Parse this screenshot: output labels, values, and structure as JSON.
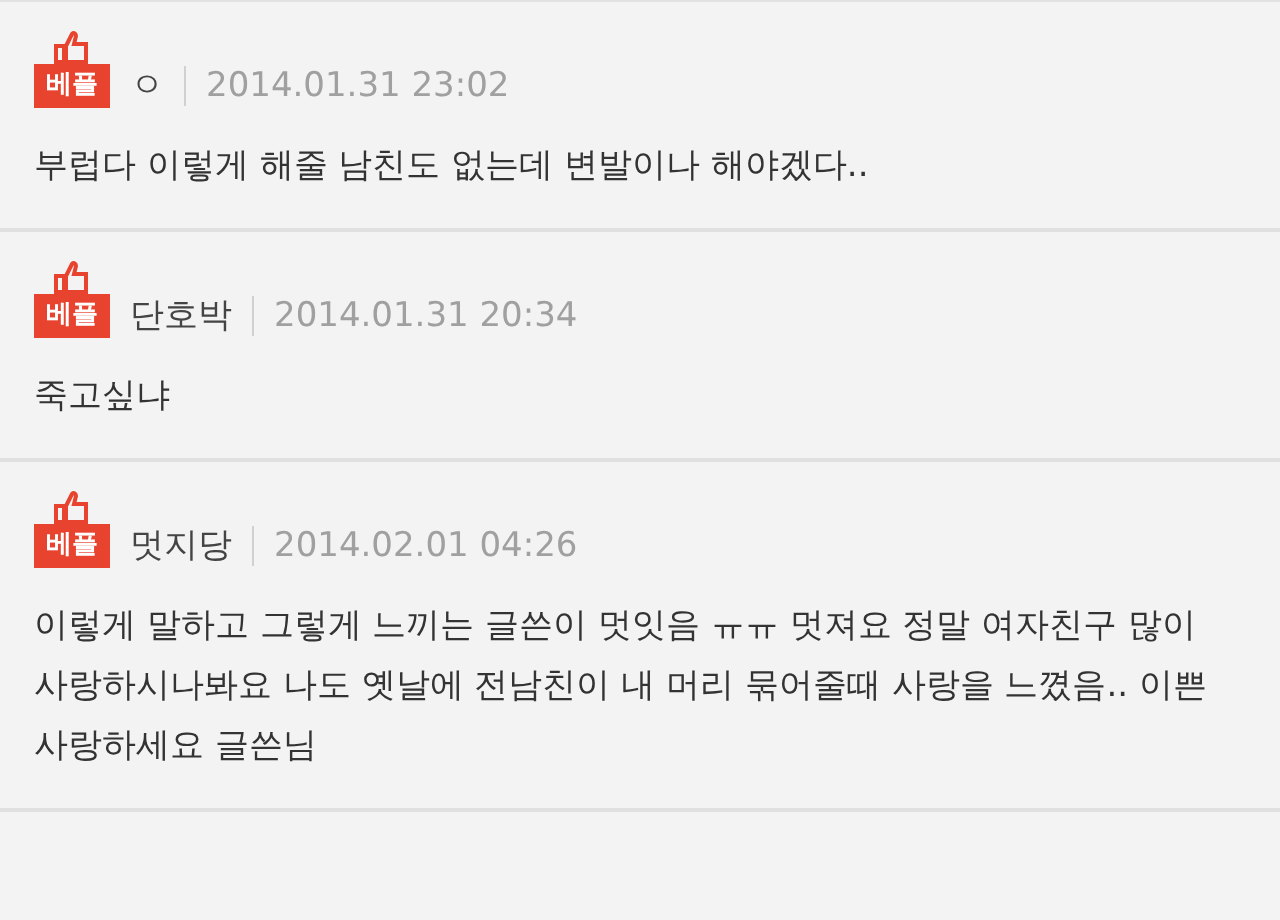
{
  "comments": [
    {
      "badge": "베플",
      "author": "ㅇ",
      "date": "2014.01.31 23:02",
      "body": "부럽다 이렇게 해줄 남친도 없는데 변발이나 해야겠다.."
    },
    {
      "badge": "베플",
      "author": "단호박",
      "date": "2014.01.31 20:34",
      "body": "죽고싶냐"
    },
    {
      "badge": "베플",
      "author": "멋지당",
      "date": "2014.02.01 04:26",
      "body": "이렇게 말하고 그렇게 느끼는 글쓴이 멋잇음 ㅠㅠ 멋져요 정말 여자친구 많이 사랑하시나봐요 나도 옛날에 전남친이 내 머리 묶어줄때 사랑을 느꼈음.. 이쁜사랑하세요 글쓴님"
    }
  ]
}
